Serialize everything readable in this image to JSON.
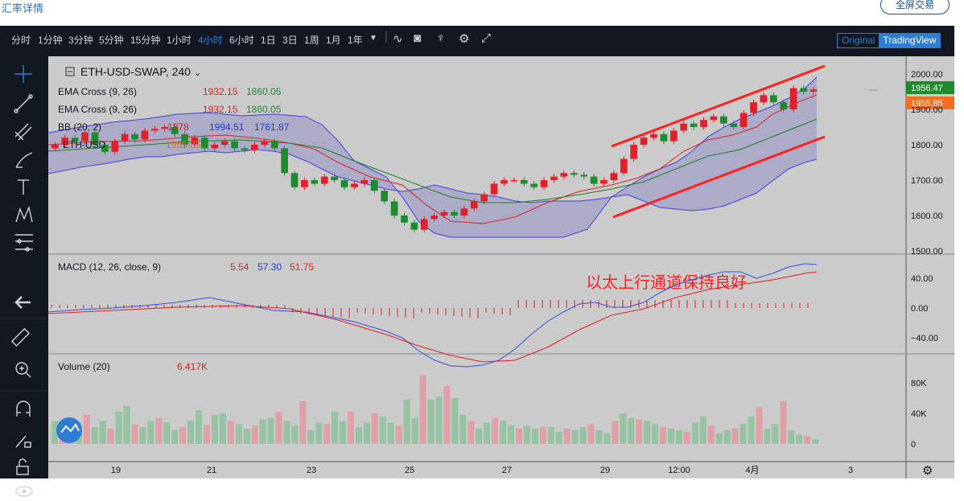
{
  "page": {
    "title": "汇率详情",
    "fullscreen_label": "全屏交易"
  },
  "toolbar": {
    "intervals": [
      "分时",
      "1分钟",
      "3分钟",
      "5分钟",
      "15分钟",
      "1小时",
      "4小时",
      "6小时",
      "1日",
      "3日",
      "1周",
      "1月",
      "1年"
    ],
    "active_interval": "4小时",
    "view_original": "Original",
    "view_tradingview": "TradingView",
    "icons": [
      "dropdown-caret-icon",
      "indicator-wave-icon",
      "camera-icon",
      "compare-icon",
      "settings-icon",
      "fullscreen-icon"
    ]
  },
  "left_tools": [
    "crosshair-icon",
    "trendline-icon",
    "pitchfork-icon",
    "brush-icon",
    "text-tool-icon",
    "pattern-icon",
    "measure-icon",
    "back-arrow-icon",
    "ruler-icon",
    "zoom-icon",
    "magnet-icon",
    "lock-draw-icon",
    "lock-icon",
    "eye-icon"
  ],
  "legend": {
    "symbol": "ETH-USD-SWAP, 240",
    "ema1": {
      "name": "EMA Cross (9, 26)",
      "v1": "1932.15",
      "v2": "1860.05"
    },
    "ema2": {
      "name": "EMA Cross (9, 26)",
      "v1": "1932.15",
      "v2": "1860.05"
    },
    "bb": {
      "name": "BB (20, 2)",
      "v1": "1878",
      "v2": "1994.51",
      "v3": "1761.87"
    },
    "price_label": "ETH-USD",
    "price_value": "1955.85",
    "macd": {
      "name": "MACD (12, 26, close, 9)",
      "v1": "5.54",
      "v2": "57.30",
      "v3": "51.75"
    },
    "volume": {
      "name": "Volume (20)",
      "v1": "6.417K"
    }
  },
  "annotation": "以太上行通道保持良好",
  "price_axis": {
    "ticks": [
      "2000.00",
      "1900.00",
      "1800.00",
      "1700.00",
      "1600.00",
      "1500.00"
    ],
    "last_price": "1956.47",
    "last_price2": "1955.85"
  },
  "macd_axis": {
    "ticks": [
      "40.00",
      "0.00",
      "−40.00"
    ]
  },
  "volume_axis": {
    "ticks": [
      "80K",
      "40K",
      "0"
    ]
  },
  "time_axis": {
    "ticks": [
      "19",
      "21",
      "23",
      "25",
      "27",
      "29",
      "12:00",
      "4月",
      "3"
    ]
  },
  "colors": {
    "up": "#e0202a",
    "down": "#1e8c2e",
    "bg": "#c8c8c8",
    "band": "#a8a8c8"
  },
  "chart_data": {
    "type": "candlestick",
    "title": "ETH-USD-SWAP, 240",
    "xlabel": "",
    "ylabel": "",
    "ylim": [
      1500,
      2000
    ],
    "x_ticks": [
      "19",
      "21",
      "23",
      "25",
      "27",
      "29",
      "12:00",
      "4月",
      "3"
    ],
    "ohlc_close_approx": [
      1800,
      1820,
      1810,
      1835,
      1800,
      1780,
      1810,
      1830,
      1815,
      1840,
      1845,
      1850,
      1830,
      1800,
      1820,
      1790,
      1800,
      1810,
      1790,
      1785,
      1800,
      1810,
      1790,
      1720,
      1680,
      1700,
      1690,
      1710,
      1700,
      1680,
      1690,
      1700,
      1670,
      1640,
      1600,
      1580,
      1560,
      1590,
      1600,
      1610,
      1600,
      1620,
      1640,
      1660,
      1690,
      1700,
      1700,
      1690,
      1680,
      1700,
      1710,
      1720,
      1715,
      1710,
      1690,
      1700,
      1720,
      1760,
      1800,
      1820,
      1830,
      1810,
      1840,
      1860,
      1850,
      1870,
      1880,
      1860,
      1850,
      1890,
      1920,
      1940,
      1920,
      1900,
      1960,
      1950,
      1956
    ]
  }
}
